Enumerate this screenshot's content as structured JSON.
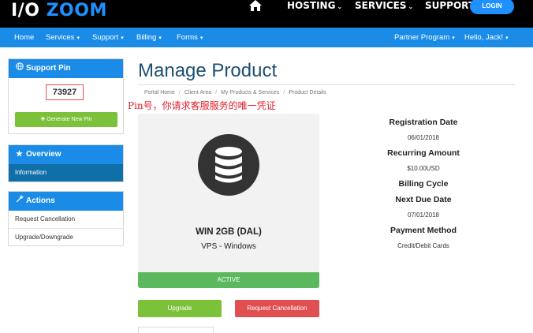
{
  "brand": {
    "logo_prefix": "I/O",
    "logo_suffix": "ZOOM",
    "accent": "#1e90ff"
  },
  "topnav": {
    "home_icon": "home-icon",
    "items": [
      {
        "label": "HOSTING",
        "has_caret": true
      },
      {
        "label": "SERVICES",
        "has_caret": true
      },
      {
        "label": "SUPPORT",
        "has_caret": false
      }
    ],
    "login_label": "LOGIN"
  },
  "navbar": {
    "left": [
      "Home",
      "Services",
      "Support",
      "Billing",
      "Forms"
    ],
    "right": [
      "Partner Program",
      "Hello, Jack!"
    ],
    "caret": "▾",
    "color": "#1a8ce8"
  },
  "sidebar": {
    "support_pin": {
      "title": "Support Pin",
      "icon": "globe-icon",
      "pin": "73927",
      "button_label": "✚ Generate New Pin"
    },
    "overview": {
      "title": "Overview",
      "icon": "star-icon",
      "items": [
        "Information"
      ]
    },
    "actions": {
      "title": "Actions",
      "icon": "wrench-icon",
      "items": [
        "Request Cancellation",
        "Upgrade/Downgrade"
      ]
    }
  },
  "main": {
    "title": "Manage Product",
    "breadcrumb": [
      "Portal Home",
      "Client Area",
      "My Products & Services",
      "Product Details"
    ],
    "annotation": "Pin号，你请求客服服务的唯一凭证",
    "product": {
      "icon": "database-icon",
      "name": "WIN 2GB (DAL)",
      "group": "VPS - Windows",
      "status": "ACTIVE"
    },
    "buttons": {
      "upgrade": "Upgrade",
      "cancel": "Request Cancellation"
    },
    "details": {
      "registration_date_label": "Registration Date",
      "registration_date": "06/01/2018",
      "recurring_amount_label": "Recurring Amount",
      "recurring_amount": "$10.00USD",
      "billing_cycle_label": "Billing Cycle",
      "next_due_date_label": "Next Due Date",
      "next_due_date": "07/01/2018",
      "payment_method_label": "Payment Method",
      "payment_method": "Credit/Debit Cards"
    }
  },
  "colors": {
    "active_green": "#5cb85c",
    "upgrade_green": "#7cc13a",
    "cancel_red": "#e05050",
    "title_navy": "#1d4f73"
  }
}
